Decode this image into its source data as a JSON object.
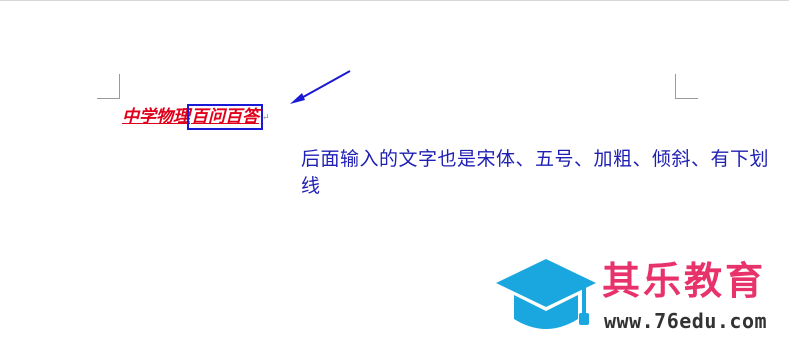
{
  "document": {
    "line_part_1": "中学物理",
    "line_part_2_boxed": "百问百答",
    "annotation": "后面输入的文字也是宋体、五号、加粗、倾斜、有下划线",
    "colors": {
      "doc_text": "#e0001b",
      "highlight_box": "#1a1ad6",
      "annotation": "#1f1fb4"
    }
  },
  "logo": {
    "title": "其乐教育",
    "url": "www.76edu.com",
    "icon": "graduation-cap-icon",
    "colors": {
      "cap": "#1aa7e0",
      "title": "#e8326b",
      "url": "#333333"
    }
  }
}
